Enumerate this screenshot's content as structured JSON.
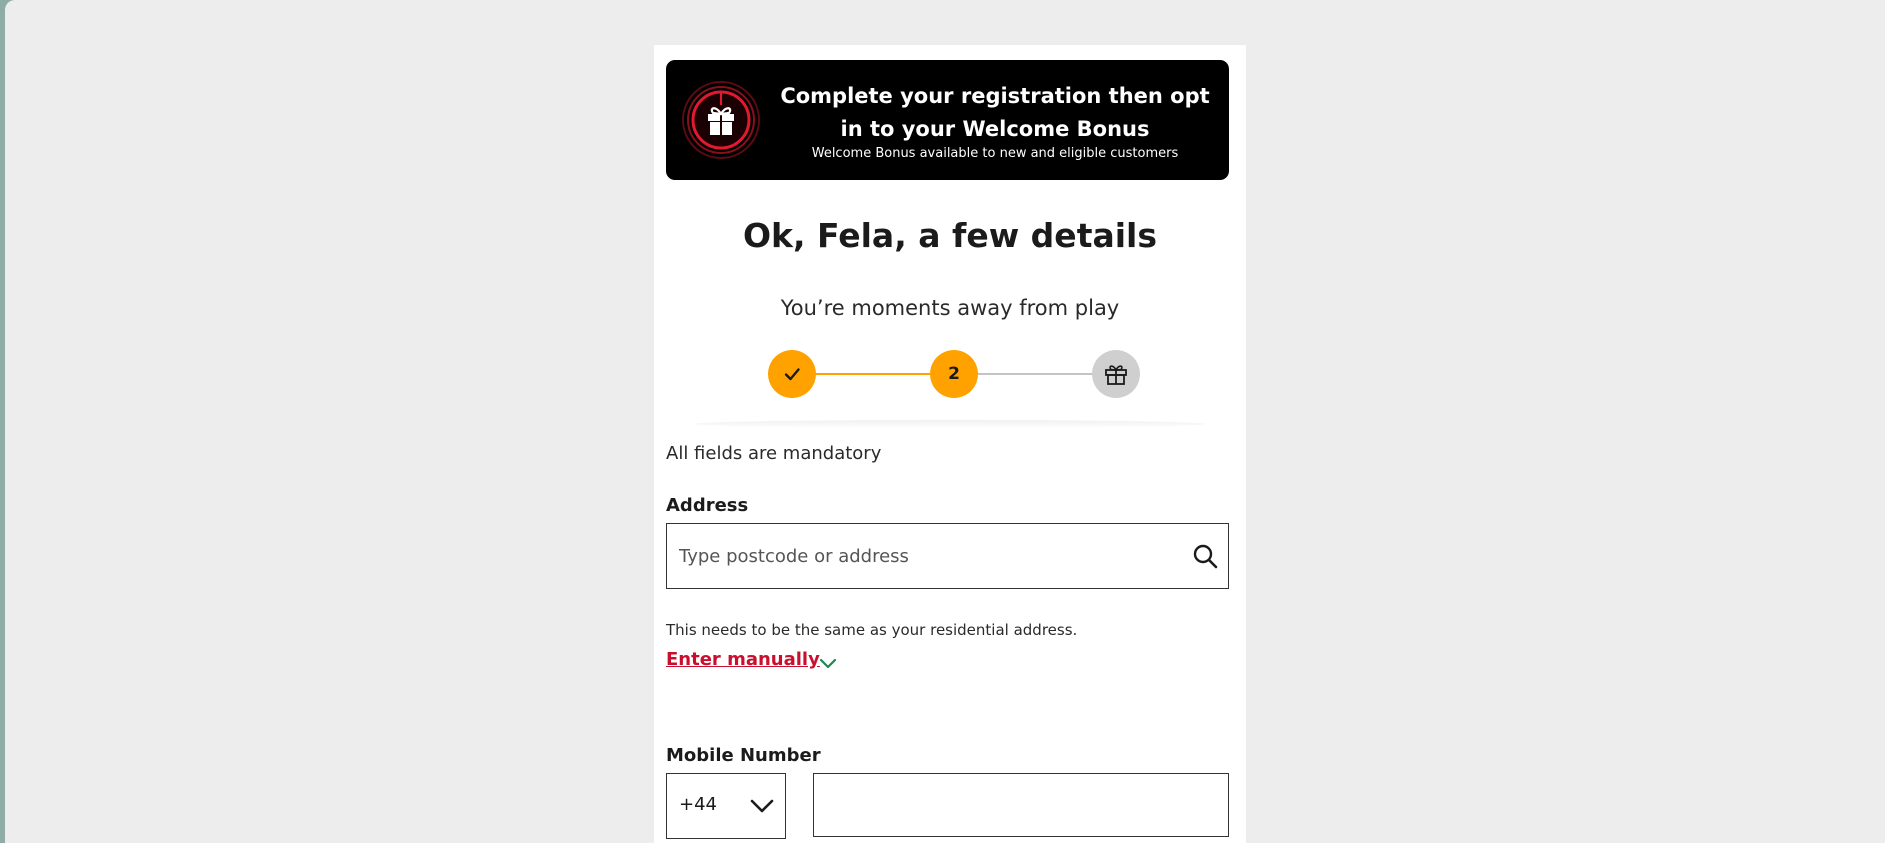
{
  "banner": {
    "title": "Complete your registration then opt in to your Welcome Bonus",
    "subtitle": "Welcome Bonus available to new and eligible customers",
    "icon": "gift-icon"
  },
  "page": {
    "title": "Ok, Fela, a few details",
    "subtitle": "You’re moments away from play"
  },
  "stepper": {
    "steps": [
      {
        "state": "complete",
        "icon": "checkmark-icon"
      },
      {
        "state": "current",
        "label": "2"
      },
      {
        "state": "upcoming",
        "icon": "gift-icon"
      }
    ],
    "colors": {
      "active": "#ffa200",
      "inactive": "#cfcfcf"
    }
  },
  "form": {
    "mandatory_note": "All fields are mandatory",
    "address": {
      "label": "Address",
      "placeholder": "Type postcode or address",
      "hint": "This needs to be the same as your residential address.",
      "manual_link": "Enter manually"
    },
    "mobile": {
      "label": "Mobile Number",
      "country_code": "+44",
      "value": ""
    }
  },
  "colors": {
    "brand_red": "#c8102e",
    "link_chevron": "#1a8a4a"
  }
}
